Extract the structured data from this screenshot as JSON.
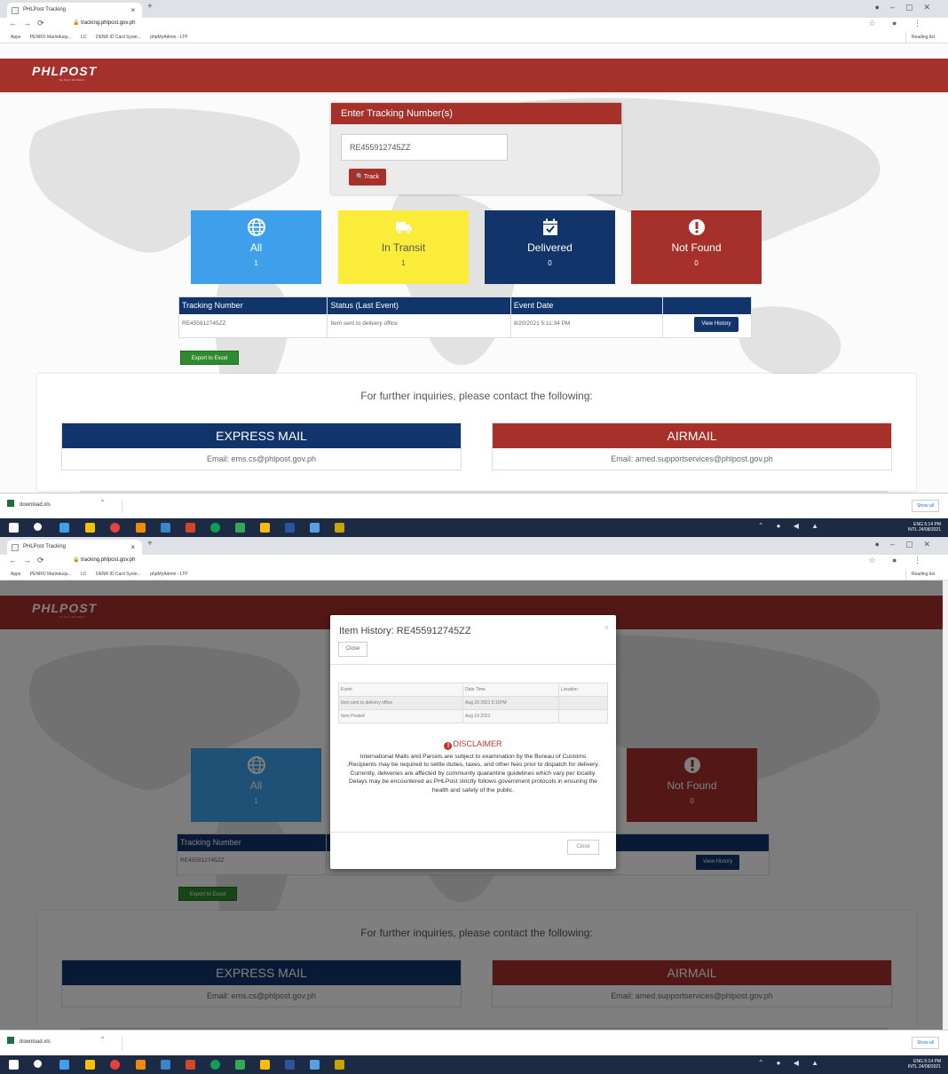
{
  "browser": {
    "tab_title": "PHLPost Tracking",
    "tab_close": "×",
    "new_tab": "+",
    "url": "tracking.phlpost.gov.ph",
    "bookmarks": [
      "Apps",
      "PENRO Marinduqu...",
      "LC",
      "DENR ID Card Syste...",
      "phpMyAdmin - LTP"
    ],
    "reading_list": "Reading list"
  },
  "header": {
    "logo": "PHLPOST",
    "tagline": "You Send. We Deliver."
  },
  "tracking_box": {
    "title": "Enter Tracking Number(s)",
    "input_value": "RE455912745ZZ",
    "track_label": "Track"
  },
  "status_cards": [
    {
      "label": "All",
      "count": "1",
      "icon": "globe-icon",
      "color": "#3ea0eb"
    },
    {
      "label": "In Transit",
      "count": "1",
      "icon": "truck-icon",
      "color": "#fcec3a"
    },
    {
      "label": "Delivered",
      "count": "0",
      "icon": "calendar-check-icon",
      "color": "#11356a"
    },
    {
      "label": "Not Found",
      "count": "0",
      "icon": "exclamation-circle-icon",
      "color": "#a6302a"
    }
  ],
  "results_table": {
    "headers": [
      "Tracking Number",
      "Status (Last Event)",
      "Event Date",
      ""
    ],
    "rows": [
      {
        "tracking_number": "RE455912745ZZ",
        "status": "Item sent to delivery office",
        "event_date": "8/20/2021 5:11:34 PM",
        "action": "View History"
      }
    ]
  },
  "export_label": "Export to Excel",
  "contact": {
    "title": "For further inquiries, please contact the following:",
    "express": {
      "title": "EXPRESS MAIL",
      "email": "Email: ems.cs@phlpost.gov.ph"
    },
    "airmail": {
      "title": "AIRMAIL",
      "email": "Email: amed.supportservices@phlpost.gov.ph"
    }
  },
  "downloads": {
    "file": "download.xls",
    "show_all": "Show all"
  },
  "taskbar": {
    "lang": "ENG",
    "lang2": "INTL",
    "time": "5:14 PM",
    "date": "24/08/2021"
  },
  "modal": {
    "title": "Item History: RE455912745ZZ",
    "close_label": "Close",
    "x_label": "×",
    "table_headers": [
      "Event",
      "Date Time",
      "Location"
    ],
    "rows": [
      {
        "event": "Item sent to delivery office",
        "datetime": "Aug 20 2021 5:11PM",
        "location": ""
      },
      {
        "event": "Item Posted",
        "datetime": "Aug 19 2021",
        "location": ""
      }
    ],
    "disclaimer_title": "DISCLAIMER",
    "disclaimer_text": "International Mails and Parcels are subject to examination by the Bureau of Customs ,Recipients may be required to settle duties, taxes, and other fees prior to dispatch for delivery. Currently, deliveries are affected by community quarantine guidelines which vary per locality. Delays may be encountered as PHLPost strictly follows government protocols in ensuring the health and safety of the public."
  },
  "colors": {
    "brand_red": "#a6302a",
    "navy": "#11356a",
    "sky": "#3ea0eb",
    "yellow": "#fcec3a",
    "excel_green": "#2e8b2e"
  }
}
